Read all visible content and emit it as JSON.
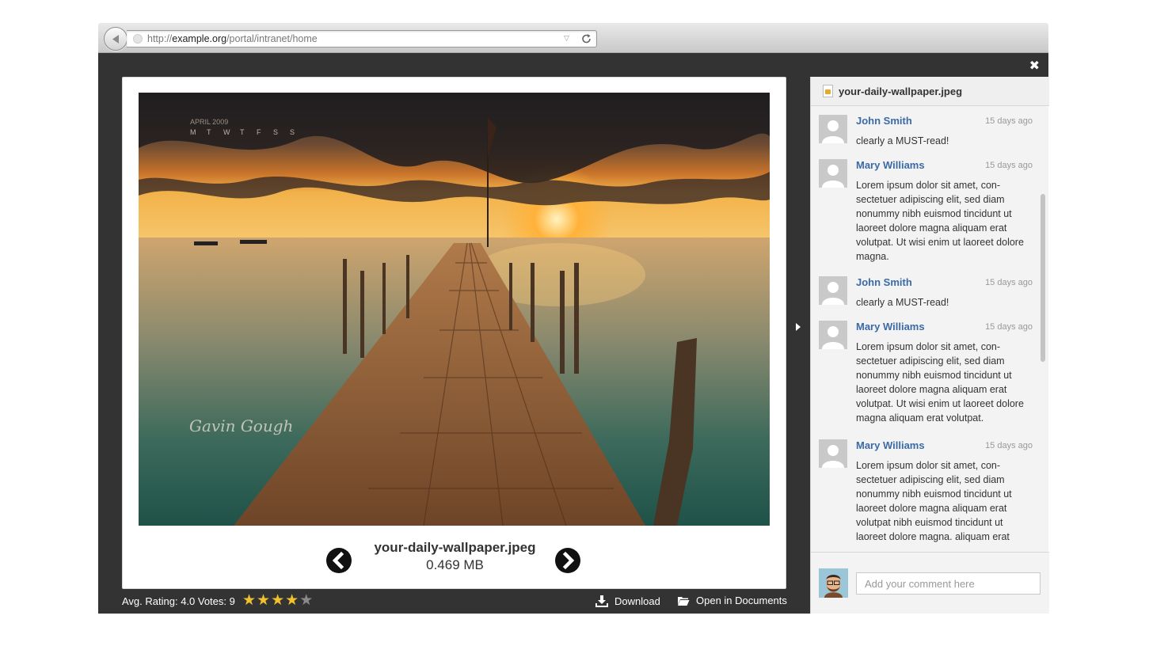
{
  "browser": {
    "url_prefix": "http://",
    "url_domain": "example.org",
    "url_path": "/portal/intranet/home"
  },
  "viewer": {
    "file_name": "your-daily-wallpaper.jpeg",
    "file_size": "0.469 MB",
    "rating_text": "Avg. Rating: 4.0 Votes: 9",
    "rating": 4,
    "rating_max": 5,
    "download_label": "Download",
    "open_label": "Open in Documents",
    "photo_watermark": "Gavin Gough",
    "photo_calendar_month": "APRIL 2009",
    "photo_calendar_days": [
      "M",
      "T",
      "W",
      "T",
      "F",
      "S",
      "S"
    ]
  },
  "sidebar": {
    "title": "your-daily-wallpaper.jpeg",
    "comments": [
      {
        "author": "John Smith",
        "time": "15 days ago",
        "text": "clearly a MUST-read!"
      },
      {
        "author": "Mary Williams",
        "time": "15 days ago",
        "text": "Lorem ipsum dolor sit amet, con-sectetuer adipiscing elit, sed diam nonummy nibh euismod tincidunt ut laoreet dolore magna aliquam erat volutpat. Ut wisi enim ut laoreet dolore magna."
      },
      {
        "author": "John Smith",
        "time": "15 days ago",
        "text": "clearly a MUST-read!"
      },
      {
        "author": "Mary Williams",
        "time": "15 days ago",
        "text": "Lorem ipsum dolor sit amet, con-sectetuer adipiscing elit, sed diam nonummy nibh euismod tincidunt ut laoreet dolore magna aliquam erat volutpat. Ut wisi enim ut laoreet dolore magna aliquam erat volutpat."
      },
      {
        "author": "Mary Williams",
        "time": "15 days ago",
        "text": "Lorem ipsum dolor sit amet, con-sectetuer adipiscing elit, sed diam nonummy nibh euismod tincidunt ut laoreet dolore magna aliquam erat volutpat nibh euismod tincidunt ut laoreet dolore magna. aliquam erat"
      }
    ],
    "compose_placeholder": "Add your comment here"
  },
  "colors": {
    "viewer_background": "#333333",
    "author_link": "#3b6aa6",
    "star_on": "#f2c12e"
  },
  "icons": [
    "back-arrow-icon",
    "reload-icon",
    "close-icon",
    "chevron-left-icon",
    "chevron-right-icon",
    "download-icon",
    "folder-open-icon",
    "star-icon",
    "file-image-icon"
  ]
}
